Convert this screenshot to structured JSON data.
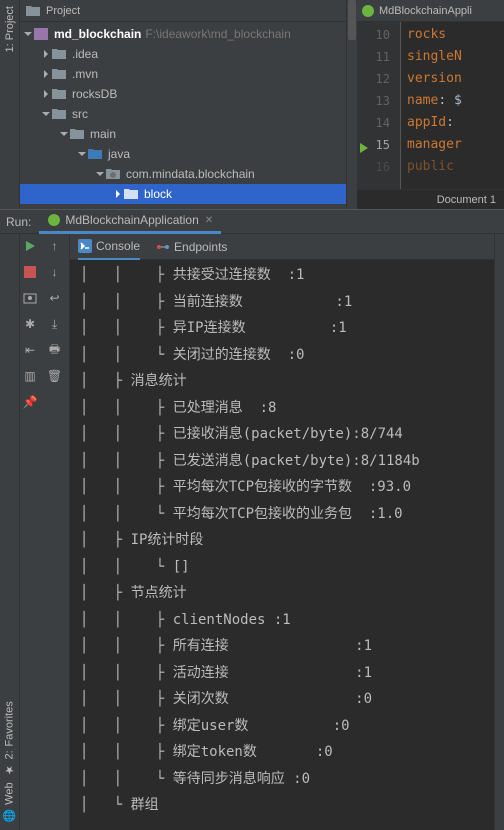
{
  "left_tabs": {
    "project": {
      "num": "1:",
      "label": "Project"
    }
  },
  "left_tabs_bottom": {
    "favorites": {
      "num": "2:",
      "label": "Favorites"
    },
    "web": "Web"
  },
  "tree": {
    "header": "Project",
    "root": {
      "label": "md_blockchain",
      "path": "F:\\ideawork\\md_blockchain"
    },
    "items": [
      {
        "label": ".idea"
      },
      {
        "label": ".mvn"
      },
      {
        "label": "rocksDB"
      },
      {
        "label": "src"
      },
      {
        "label": "main"
      },
      {
        "label": "java"
      },
      {
        "label": "com.mindata.blockchain"
      },
      {
        "label": "block"
      }
    ]
  },
  "editor": {
    "tab": "MdBlockchainAppli",
    "lines": [
      {
        "num": "10",
        "key": "rocks"
      },
      {
        "num": "11",
        "key": "singleN"
      },
      {
        "num": "12",
        "key": "version"
      },
      {
        "num": "13",
        "key": "name",
        "val": ": $"
      },
      {
        "num": "14",
        "key": "appId",
        "val": ": "
      },
      {
        "num": "15",
        "key": "manager"
      },
      {
        "num": "16",
        "key": "public"
      }
    ],
    "status": "Document 1"
  },
  "run": {
    "title": "Run:",
    "tab": "MdBlockchainApplication",
    "subtabs": {
      "console": "Console",
      "endpoints": "Endpoints"
    }
  },
  "console_lines": [
    "│    ├ 共接受过连接数  :1",
    "│    ├ 当前连接数           :1",
    "│    ├ 异IP连接数          :1",
    "│    └ 关闭过的连接数  :0",
    "├ 消息统计",
    "│    ├ 已处理消息  :8",
    "│    ├ 已接收消息(packet/byte):8/744",
    "│    ├ 已发送消息(packet/byte):8/1184b",
    "│    ├ 平均每次TCP包接收的字节数  :93.0",
    "│    └ 平均每次TCP包接收的业务包  :1.0",
    "├ IP统计时段 ",
    "│    └ []",
    "├ 节点统计",
    "│    ├ clientNodes :1",
    "│    ├ 所有连接               :1",
    "│    ├ 活动连接               :1",
    "│    ├ 关闭次数               :0",
    "│    ├ 绑定user数          :0",
    "│    ├ 绑定token数       :0",
    "│    └ 等待同步消息响应 :0",
    "└ 群组"
  ]
}
